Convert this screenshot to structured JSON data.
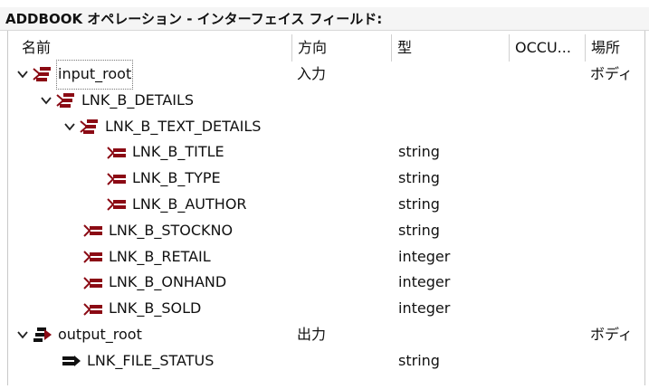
{
  "panel": {
    "title": "ADDBOOK オペレーション - インターフェイス フィールド:"
  },
  "columns": {
    "name": "名前",
    "direction": "方向",
    "type": "型",
    "occurs": "OCCU...",
    "location": "場所"
  },
  "rows": [
    {
      "name": "input_root",
      "direction": "入力",
      "type": "",
      "location": "ボディ",
      "icon": "structure-input-icon"
    },
    {
      "name": "LNK_B_DETAILS",
      "direction": "",
      "type": "",
      "location": "",
      "icon": "structure-input-icon"
    },
    {
      "name": "LNK_B_TEXT_DETAILS",
      "direction": "",
      "type": "",
      "location": "",
      "icon": "structure-input-icon"
    },
    {
      "name": "LNK_B_TITLE",
      "direction": "",
      "type": "string",
      "location": "",
      "icon": "field-input-icon"
    },
    {
      "name": "LNK_B_TYPE",
      "direction": "",
      "type": "string",
      "location": "",
      "icon": "field-input-icon"
    },
    {
      "name": "LNK_B_AUTHOR",
      "direction": "",
      "type": "string",
      "location": "",
      "icon": "field-input-icon"
    },
    {
      "name": "LNK_B_STOCKNO",
      "direction": "",
      "type": "string",
      "location": "",
      "icon": "field-input-icon"
    },
    {
      "name": "LNK_B_RETAIL",
      "direction": "",
      "type": "integer",
      "location": "",
      "icon": "field-input-icon"
    },
    {
      "name": "LNK_B_ONHAND",
      "direction": "",
      "type": "integer",
      "location": "",
      "icon": "field-input-icon"
    },
    {
      "name": "LNK_B_SOLD",
      "direction": "",
      "type": "integer",
      "location": "",
      "icon": "field-input-icon"
    },
    {
      "name": "output_root",
      "direction": "出力",
      "type": "",
      "location": "ボディ",
      "icon": "structure-output-icon"
    },
    {
      "name": "LNK_FILE_STATUS",
      "direction": "",
      "type": "string",
      "location": "",
      "icon": "field-output-icon"
    }
  ],
  "colors": {
    "icon_input": "#8b0a14",
    "icon_output": "#111111",
    "header_bg": "#f5f5f5"
  }
}
